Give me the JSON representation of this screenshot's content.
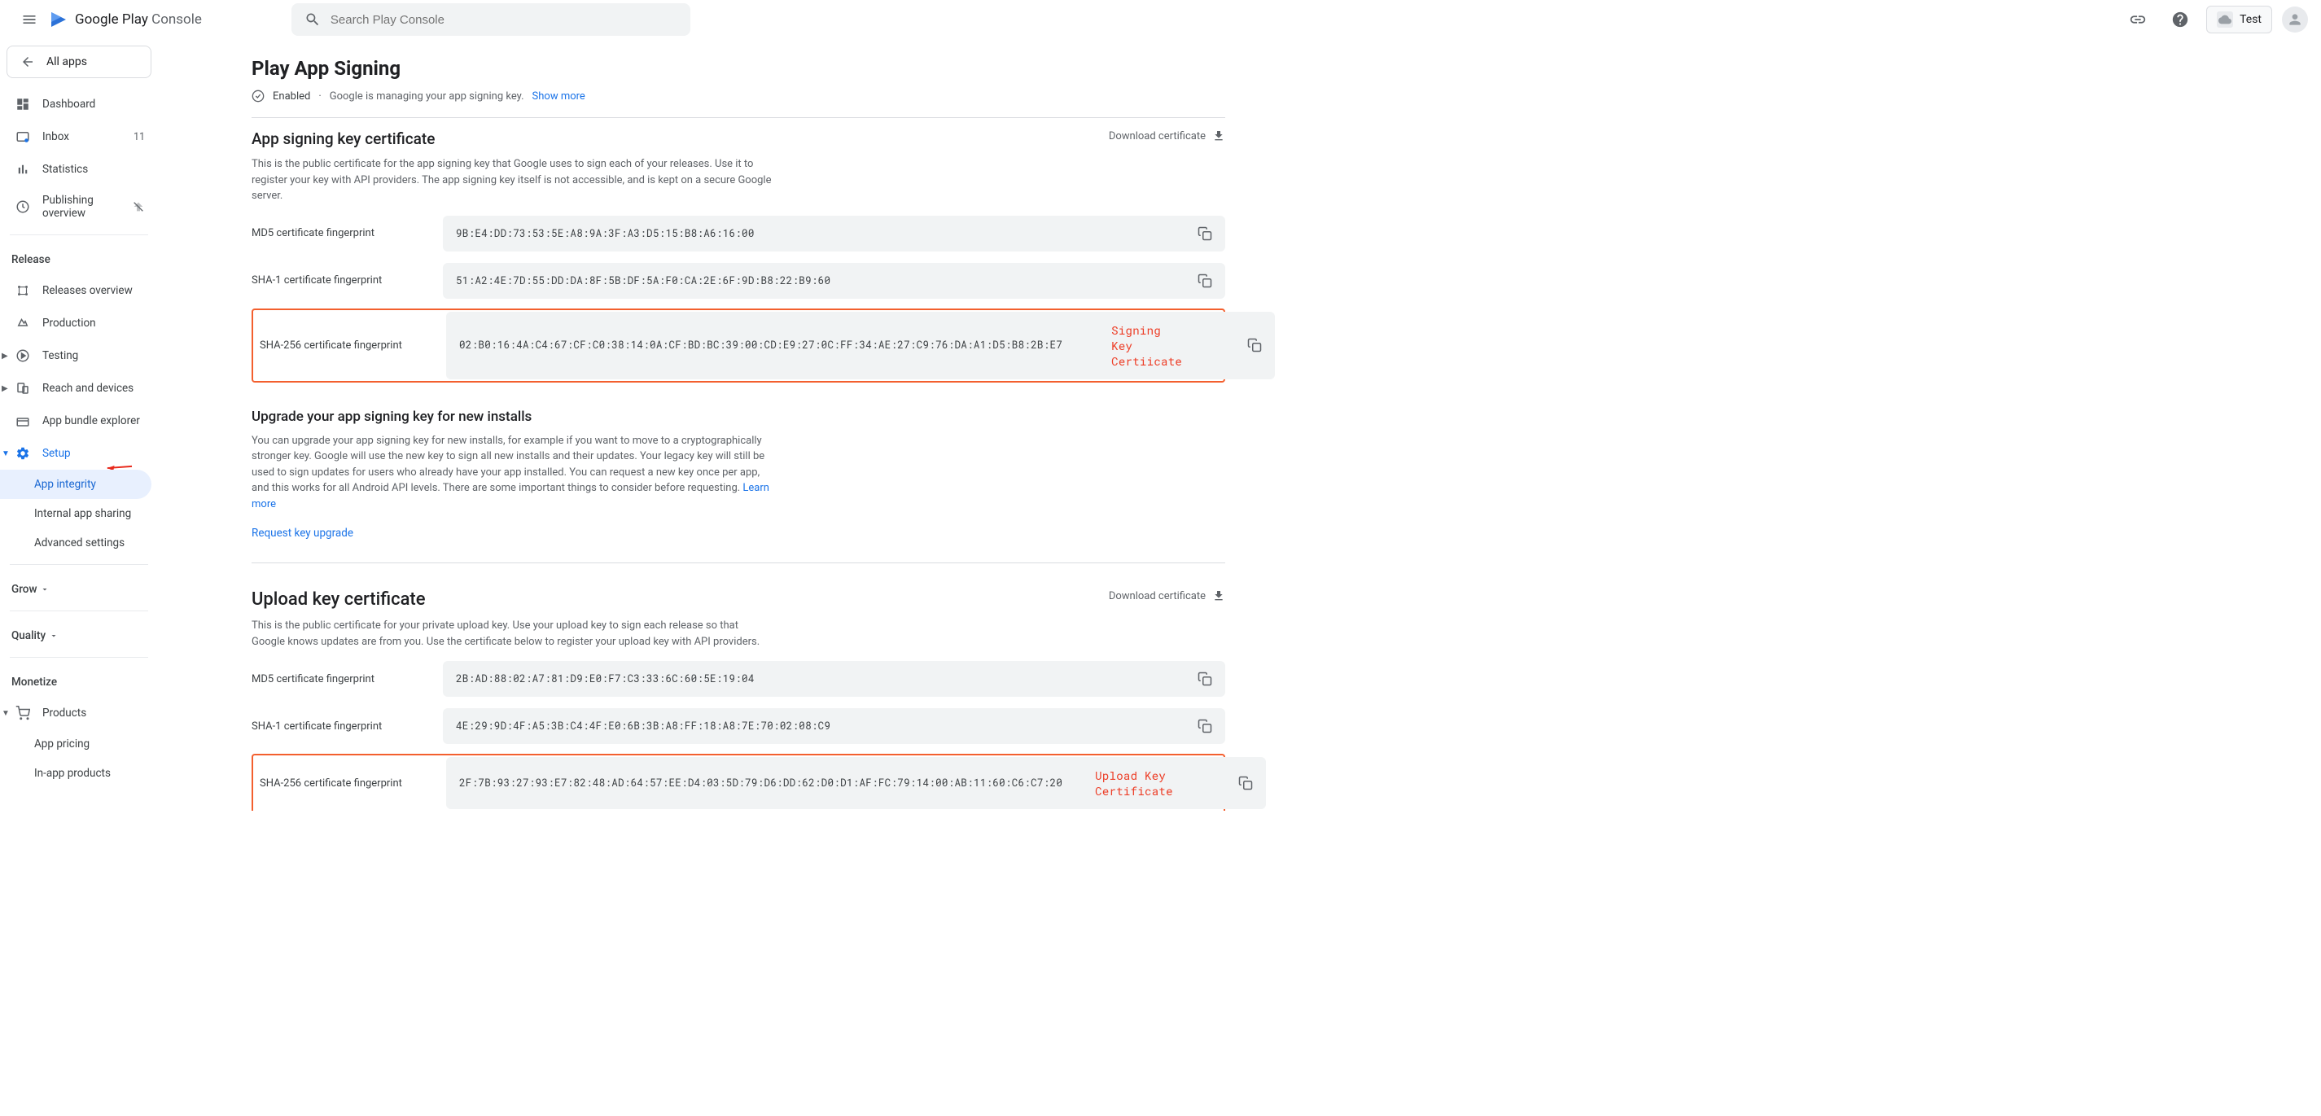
{
  "header": {
    "logo_text_g": "Google Play",
    "logo_text_c": " Console",
    "search_placeholder": "Search Play Console",
    "app_name": "Test"
  },
  "sidebar": {
    "all_apps": "All apps",
    "dashboard": "Dashboard",
    "inbox": "Inbox",
    "inbox_count": "11",
    "statistics": "Statistics",
    "publishing": "Publishing overview",
    "release_section": "Release",
    "releases_overview": "Releases overview",
    "production": "Production",
    "testing": "Testing",
    "reach": "Reach and devices",
    "bundle_explorer": "App bundle explorer",
    "setup": "Setup",
    "app_integrity": "App integrity",
    "internal_sharing": "Internal app sharing",
    "advanced_settings": "Advanced settings",
    "grow_section": "Grow",
    "quality_section": "Quality",
    "monetize_section": "Monetize",
    "products": "Products",
    "app_pricing": "App pricing",
    "in_app_products": "In-app products"
  },
  "page": {
    "title": "Play App Signing",
    "enabled": "Enabled",
    "managing": "Google is managing your app signing key.",
    "show_more": "Show more",
    "signing_cert_title": "App signing key certificate",
    "signing_cert_desc": "This is the public certificate for the app signing key that Google uses to sign each of your releases. Use it to register your key with API providers. The app signing key itself is not accessible, and is kept on a secure Google server.",
    "download_cert": "Download certificate",
    "md5_label": "MD5 certificate fingerprint",
    "sha1_label": "SHA-1 certificate fingerprint",
    "sha256_label": "SHA-256 certificate fingerprint",
    "signing_md5": "9B:E4:DD:73:53:5E:A8:9A:3F:A3:D5:15:B8:A6:16:00",
    "signing_sha1": "51:A2:4E:7D:55:DD:DA:8F:5B:DF:5A:F0:CA:2E:6F:9D:B8:22:B9:60",
    "signing_sha256": "02:B0:16:4A:C4:67:CF:C0:38:14:0A:CF:BD:BC:39:00:CD:E9:27:0C:FF:34:AE:27:C9:76:DA:A1:D5:B8:2B:E7",
    "signing_annotation": "Signing Key Certiicate",
    "upgrade_title": "Upgrade your app signing key for new installs",
    "upgrade_desc": "You can upgrade your app signing key for new installs, for example if you want to move to a cryptographically stronger key. Google will use the new key to sign all new installs and their updates. Your legacy key will still be used to sign updates for users who already have your app installed. You can request a new key once per app, and this works for all Android API levels. There are some important things to consider before requesting. ",
    "learn_more": "Learn more",
    "request_upgrade": "Request key upgrade",
    "upload_cert_title": "Upload key certificate",
    "upload_cert_desc": "This is the public certificate for your private upload key. Use your upload key to sign each release so that Google knows updates are from you. Use the certificate below to register your upload key with API providers.",
    "upload_md5": "2B:AD:88:02:A7:81:D9:E0:F7:C3:33:6C:60:5E:19:04",
    "upload_sha1": "4E:29:9D:4F:A5:3B:C4:4F:E0:6B:3B:A8:FF:18:A8:7E:70:02:08:C9",
    "upload_sha256": "2F:7B:93:27:93:E7:82:48:AD:64:57:EE:D4:03:5D:79:D6:DD:62:D0:D1:AF:FC:79:14:00:AB:11:60:C6:C7:20",
    "upload_annotation": "Upload Key Certificate"
  }
}
